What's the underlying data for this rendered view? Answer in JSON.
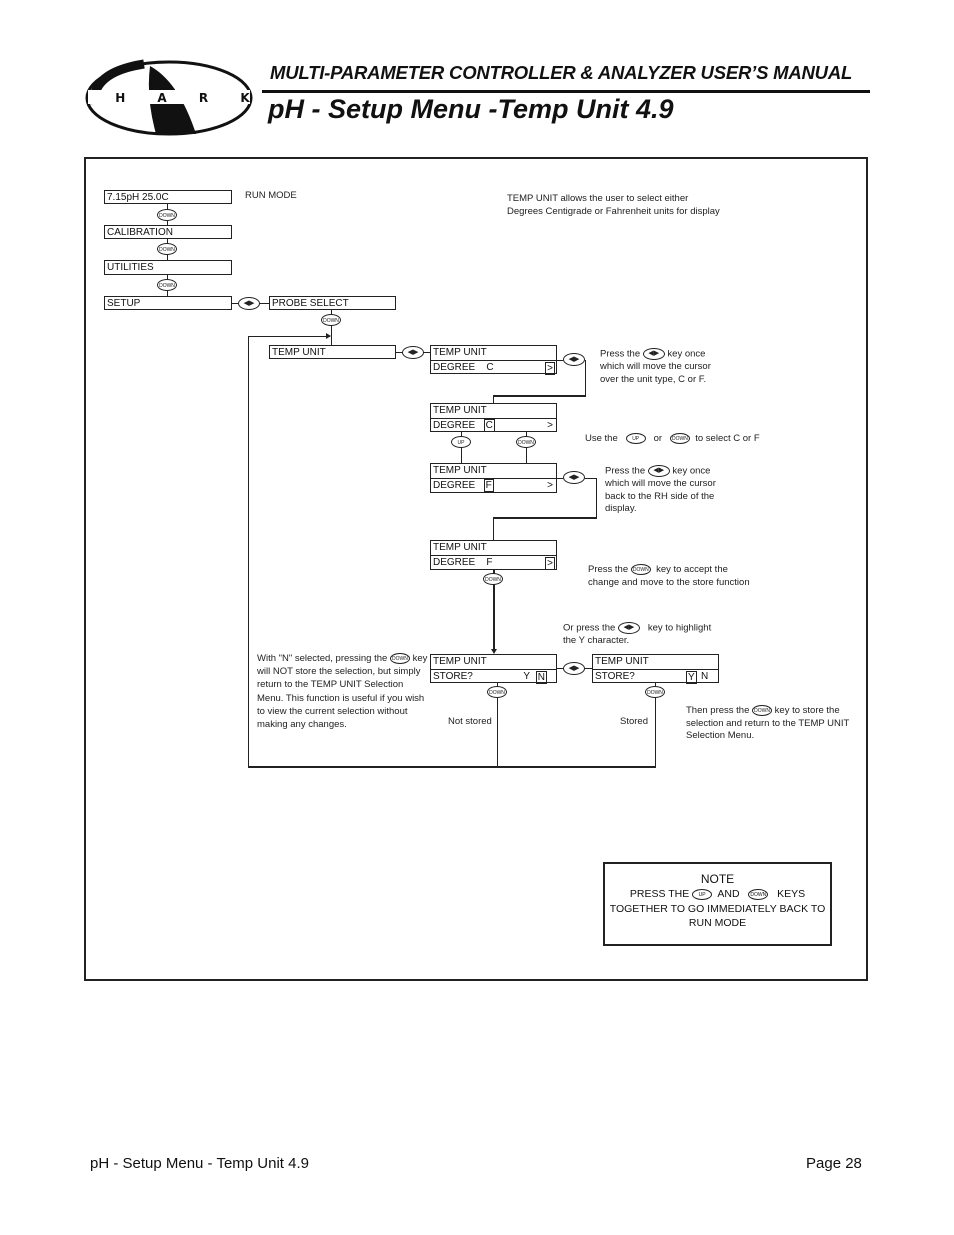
{
  "header": {
    "logo_text": "S H A R K",
    "manual_title": "MULTI-PARAMETER CONTROLLER & ANALYZER USER’S MANUAL",
    "page_title": "pH - Setup Menu -Temp Unit 4.9"
  },
  "keys": {
    "down": "DOWN",
    "up": "UP",
    "left_right": "◀▶"
  },
  "diagram": {
    "main_menu": {
      "run_display": "7.15pH   25.0C",
      "run_mode_label": "RUN MODE",
      "calibration": "CALIBRATION",
      "utilities": "UTILITIES",
      "setup": "SETUP",
      "probe_select": "PROBE SELECT",
      "temp_unit": "TEMP UNIT"
    },
    "intro_text": "TEMP UNIT allows the user to select either Degrees Centigrade or Fahrenheit units for display",
    "screens": [
      {
        "line1": "TEMP UNIT",
        "line2_label": "DEGREE",
        "line2_value": "C",
        "cursor": ">"
      },
      {
        "line1": "TEMP UNIT",
        "line2_label": "DEGREE",
        "line2_value": "C",
        "cursor": ">"
      },
      {
        "line1": "TEMP UNIT",
        "line2_label": "DEGREE",
        "line2_value": "F",
        "cursor": ">"
      },
      {
        "line1": "TEMP UNIT",
        "line2_label": "DEGREE",
        "line2_value": "F",
        "cursor": ">"
      }
    ],
    "store_screens": [
      {
        "line1": "TEMP UNIT",
        "line2_label": "STORE?",
        "yes": "Y",
        "no": "N",
        "selected": "N"
      },
      {
        "line1": "TEMP UNIT",
        "line2_label": "STORE?",
        "yes": "Y",
        "no": "N",
        "selected": "Y"
      }
    ],
    "notes": {
      "step1_pre": "Press the",
      "step1_post": "key once which will move the cursor over the unit type, C or F.",
      "step2_pre": "Use the",
      "step2_mid": "or",
      "step2_post": "to select C or F",
      "step3_pre": "Press the",
      "step3_post": "key once which will move the cursor back to the RH side of the display.",
      "step4_pre": "Press the",
      "step4_post": "key to accept the change and move to the store function",
      "step5_pre": "Or press the",
      "step5_post": "key to highlight the Y character.",
      "no_store_pre": "With \"N\" selected, pressing the",
      "no_store_post": "key will NOT store the selection, but simply return to the TEMP UNIT Selection Menu. This function is useful if you wish to view the current selection without making any changes.",
      "store_pre": "Then press the",
      "store_post": "key to store the selection and return to the TEMP UNIT Selection Menu.",
      "not_stored_label": "Not stored",
      "stored_label": "Stored"
    },
    "note_box": {
      "title": "NOTE",
      "line1_pre": "PRESS THE",
      "line1_mid": "AND",
      "line1_post": "KEYS",
      "line2": "TOGETHER TO GO IMMEDIATELY BACK TO RUN MODE"
    }
  },
  "footer": {
    "section": "pH - Setup Menu - Temp Unit 4.9",
    "page": "Page 28"
  }
}
